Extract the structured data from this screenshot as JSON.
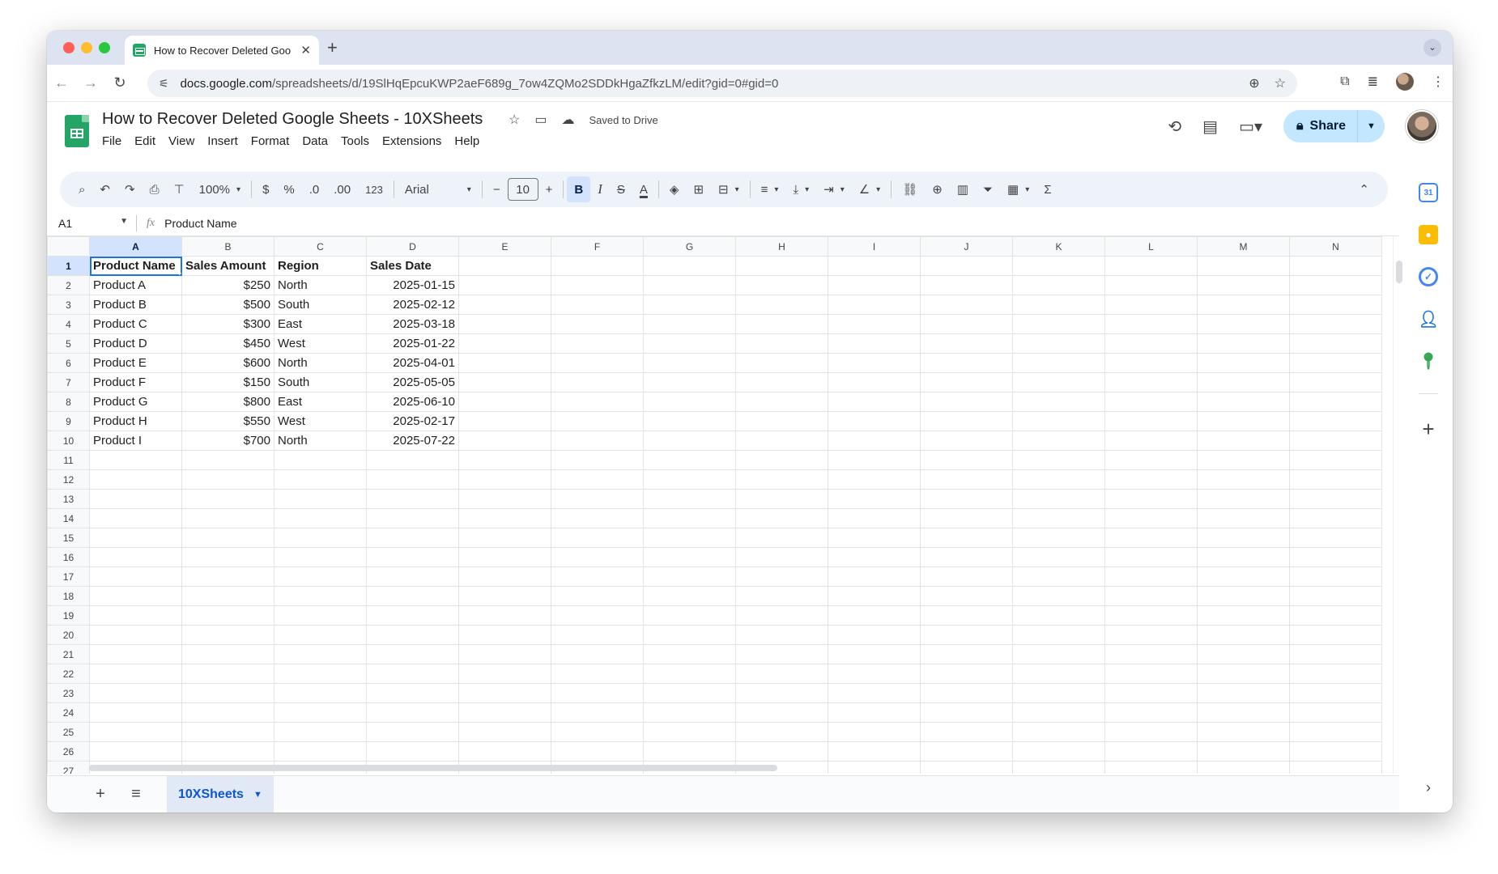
{
  "browser": {
    "tab_title": "How to Recover Deleted Goo",
    "tab_close": "✕",
    "new_tab": "+",
    "url_host": "docs.google.com",
    "url_path": "/spreadsheets/d/19SlHqEpcuKWP2aeF689g_7ow4ZQMo2SDDkHgaZfkzLM/edit?gid=0#gid=0"
  },
  "sheets": {
    "doc_title": "How to Recover Deleted Google Sheets - 10XSheets",
    "saved_status": "Saved to Drive",
    "menu": [
      "File",
      "Edit",
      "View",
      "Insert",
      "Format",
      "Data",
      "Tools",
      "Extensions",
      "Help"
    ],
    "share_label": "Share"
  },
  "toolbar": {
    "zoom": "100%",
    "currency": "$",
    "percent": "%",
    "decrease_decimal": ".0",
    "increase_decimal": ".00",
    "number_format": "123",
    "font": "Arial",
    "minus": "−",
    "font_size": "10",
    "plus": "+",
    "bold": "B",
    "italic": "I",
    "strike": "S",
    "text_color": "A",
    "sum": "Σ"
  },
  "formula_bar": {
    "cell_ref": "A1",
    "fx": "fx",
    "value": "Product Name"
  },
  "grid": {
    "columns": [
      "A",
      "B",
      "C",
      "D",
      "E",
      "F",
      "G",
      "H",
      "I",
      "J",
      "K",
      "L",
      "M",
      "N"
    ],
    "header_row": [
      "Product Name",
      "Sales Amount",
      "Region",
      "Sales Date"
    ],
    "rows": [
      [
        "Product A",
        "$250",
        "North",
        "2025-01-15"
      ],
      [
        "Product B",
        "$500",
        "South",
        "2025-02-12"
      ],
      [
        "Product C",
        "$300",
        "East",
        "2025-03-18"
      ],
      [
        "Product D",
        "$450",
        "West",
        "2025-01-22"
      ],
      [
        "Product E",
        "$600",
        "North",
        "2025-04-01"
      ],
      [
        "Product F",
        "$150",
        "South",
        "2025-05-05"
      ],
      [
        "Product G",
        "$800",
        "East",
        "2025-06-10"
      ],
      [
        "Product H",
        "$550",
        "West",
        "2025-02-17"
      ],
      [
        "Product I",
        "$700",
        "North",
        "2025-07-22"
      ]
    ],
    "row_numbers": [
      "1",
      "2",
      "3",
      "4",
      "5",
      "6",
      "7",
      "8",
      "9",
      "10",
      "11",
      "12",
      "13",
      "14",
      "15",
      "16",
      "17",
      "18",
      "19",
      "20",
      "21",
      "22",
      "23",
      "24",
      "25",
      "26",
      "27"
    ]
  },
  "sheet_tabs": {
    "add": "+",
    "all_sheets": "≡",
    "active_tab": "10XSheets"
  },
  "side_panel": {
    "calendar_label": "31",
    "add": "+",
    "expand": "›"
  },
  "colors": {
    "accent": "#1a73e8",
    "sheets_green": "#23a566",
    "share_bg": "#c2e7ff",
    "selected_header": "#d3e3fd"
  }
}
